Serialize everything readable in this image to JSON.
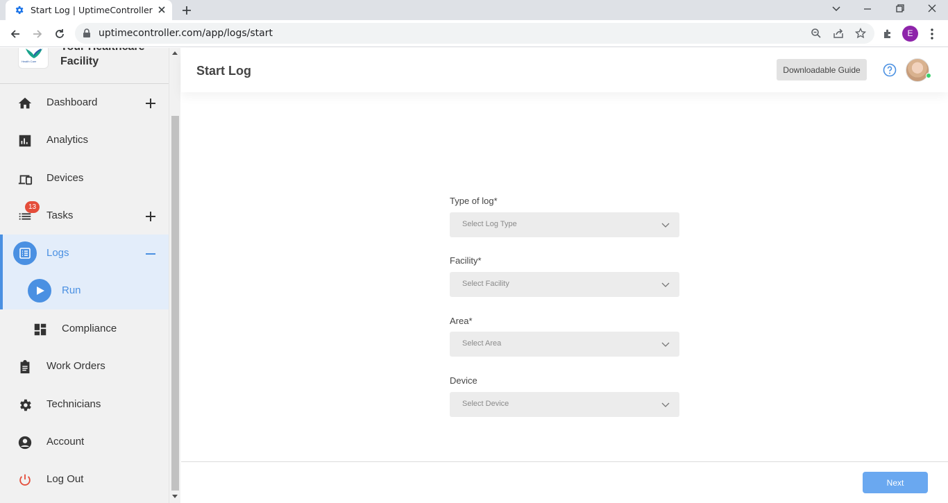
{
  "browser": {
    "tab_title": "Start Log | UptimeController",
    "url": "uptimecontroller.com/app/logs/start",
    "profile_initial": "E"
  },
  "sidebar": {
    "facility_name": "Your Healthcare Facility",
    "logo_text": "Health Care",
    "items": [
      {
        "label": "Dashboard",
        "icon": "home-icon",
        "action": "plus"
      },
      {
        "label": "Analytics",
        "icon": "analytics-icon"
      },
      {
        "label": "Devices",
        "icon": "devices-icon"
      },
      {
        "label": "Tasks",
        "icon": "list-icon",
        "action": "plus",
        "badge": "13"
      },
      {
        "label": "Logs",
        "icon": "logs-icon",
        "action": "minus",
        "active": true
      },
      {
        "label": "Run",
        "icon": "play-icon",
        "sub": true,
        "active": true
      },
      {
        "label": "Compliance",
        "icon": "dashboard-grid-icon",
        "sub": true
      },
      {
        "label": "Work Orders",
        "icon": "clipboard-icon"
      },
      {
        "label": "Technicians",
        "icon": "gear-icon"
      },
      {
        "label": "Account",
        "icon": "account-icon"
      },
      {
        "label": "Log Out",
        "icon": "power-icon"
      }
    ]
  },
  "header": {
    "title": "Start Log",
    "guide_button": "Downloadable Guide"
  },
  "form": {
    "fields": [
      {
        "label": "Type of log*",
        "placeholder": "Select Log Type"
      },
      {
        "label": "Facility*",
        "placeholder": "Select Facility"
      },
      {
        "label": "Area*",
        "placeholder": "Select Area"
      },
      {
        "label": "Device",
        "placeholder": "Select Device"
      }
    ],
    "next_button": "Next"
  },
  "colors": {
    "accent": "#4a90e2",
    "badge": "#e44d3a",
    "logout": "#e44d3a",
    "profile": "#8e24aa"
  }
}
